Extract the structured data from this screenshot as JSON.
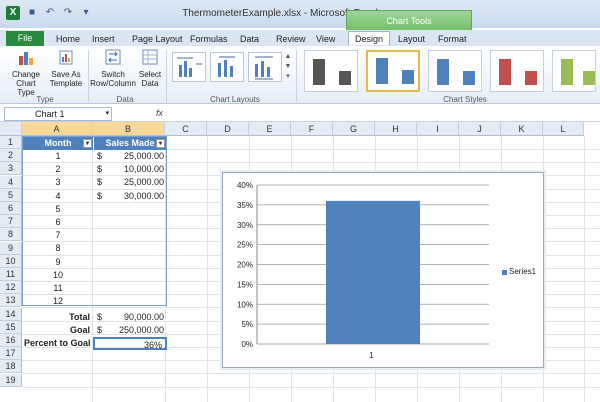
{
  "window": {
    "app_icon": "X",
    "title": "ThermometerExample.xlsx  -  Microsoft Excel",
    "context_tab": "Chart Tools"
  },
  "tabs": [
    "File",
    "Home",
    "Insert",
    "Page Layout",
    "Formulas",
    "Data",
    "Review",
    "View",
    "Design",
    "Layout",
    "Format"
  ],
  "active_tab": "Design",
  "ribbon": {
    "change_chart_type": [
      "Change",
      "Chart Type"
    ],
    "save_as_template": [
      "Save As",
      "Template"
    ],
    "switch_row_column": [
      "Switch",
      "Row/Column"
    ],
    "select_data": [
      "Select",
      "Data"
    ],
    "groups": {
      "type": "Type",
      "data": "Data",
      "chart_layouts": "Chart Layouts",
      "chart_styles": "Chart Styles"
    },
    "style_colors": [
      "#555555",
      "#4f81bd",
      "#4f81bd",
      "#c0504d",
      "#9bbb59"
    ]
  },
  "formula_bar": {
    "name_box": "Chart 1",
    "fx": "fx"
  },
  "columns": [
    "A",
    "B",
    "C",
    "D",
    "E",
    "F",
    "G",
    "H",
    "I",
    "J",
    "K",
    "L"
  ],
  "rows": [
    "1",
    "2",
    "3",
    "4",
    "5",
    "6",
    "7",
    "8",
    "9",
    "10",
    "11",
    "12",
    "13",
    "14",
    "15",
    "16",
    "17",
    "18",
    "19"
  ],
  "table": {
    "headers": [
      "Month",
      "Sales Made"
    ],
    "rows": [
      {
        "month": "1",
        "dollar": "$",
        "sales": "25,000.00"
      },
      {
        "month": "2",
        "dollar": "$",
        "sales": "10,000.00"
      },
      {
        "month": "3",
        "dollar": "$",
        "sales": "25,000.00"
      },
      {
        "month": "4",
        "dollar": "$",
        "sales": "30,000.00"
      },
      {
        "month": "5",
        "dollar": "",
        "sales": ""
      },
      {
        "month": "6",
        "dollar": "",
        "sales": ""
      },
      {
        "month": "7",
        "dollar": "",
        "sales": ""
      },
      {
        "month": "8",
        "dollar": "",
        "sales": ""
      },
      {
        "month": "9",
        "dollar": "",
        "sales": ""
      },
      {
        "month": "10",
        "dollar": "",
        "sales": ""
      },
      {
        "month": "11",
        "dollar": "",
        "sales": ""
      },
      {
        "month": "12",
        "dollar": "",
        "sales": ""
      }
    ],
    "total_label": "Total",
    "total_dollar": "$",
    "total_value": "90,000.00",
    "goal_label": "Goal",
    "goal_dollar": "$",
    "goal_value": "250,000.00",
    "pct_label": "Percent to Goal",
    "pct_value": "36%"
  },
  "chart_data": {
    "type": "bar",
    "categories": [
      "1"
    ],
    "series": [
      {
        "name": "Series1",
        "values": [
          0.36
        ]
      }
    ],
    "yticks": [
      "0%",
      "5%",
      "10%",
      "15%",
      "20%",
      "25%",
      "30%",
      "35%",
      "40%"
    ],
    "ylim": [
      0,
      0.4
    ],
    "color": "#4f81bd",
    "legend": "right",
    "grid": true
  }
}
